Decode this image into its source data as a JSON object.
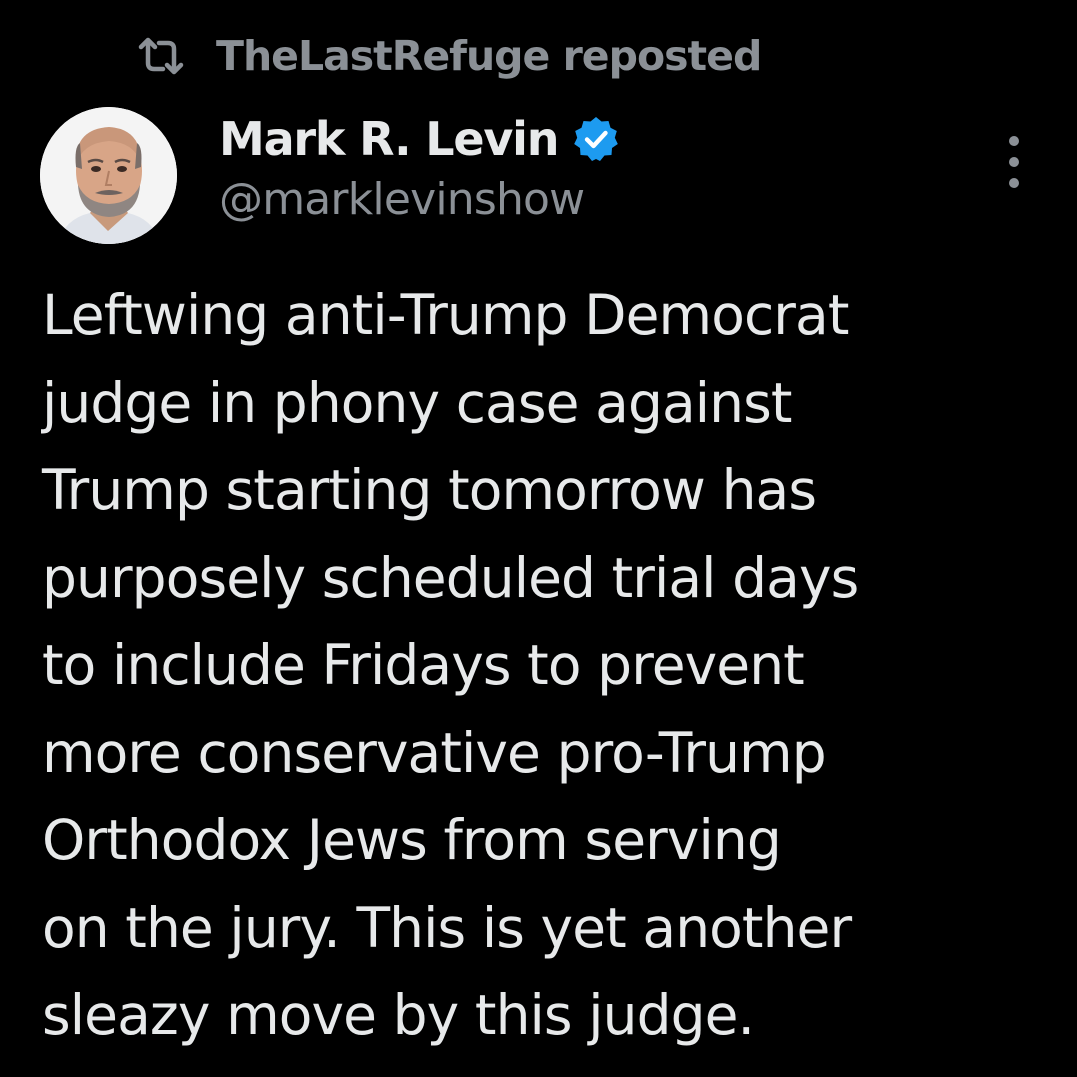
{
  "repost": {
    "icon": "repost-icon",
    "text": "TheLastRefuge reposted"
  },
  "author": {
    "avatar_icon": "avatar",
    "display_name": "Mark R. Levin",
    "verified_icon": "verified-badge-icon",
    "handle": "@marklevinshow"
  },
  "more_menu": {
    "icon": "more-vertical-icon"
  },
  "tweet": {
    "lines": [
      "Leftwing anti-Trump Democrat",
      "judge in phony case against",
      "Trump starting tomorrow has",
      "purposely scheduled trial days",
      "to include Fridays to prevent",
      "more conservative pro-Trump",
      "Orthodox Jews from serving",
      "on the jury. This is yet another",
      "sleazy move by this judge."
    ]
  },
  "colors": {
    "background": "#000000",
    "primary_text": "#e7e9ea",
    "secondary_text": "#8b9096",
    "verified_blue": "#1d9bf0"
  }
}
